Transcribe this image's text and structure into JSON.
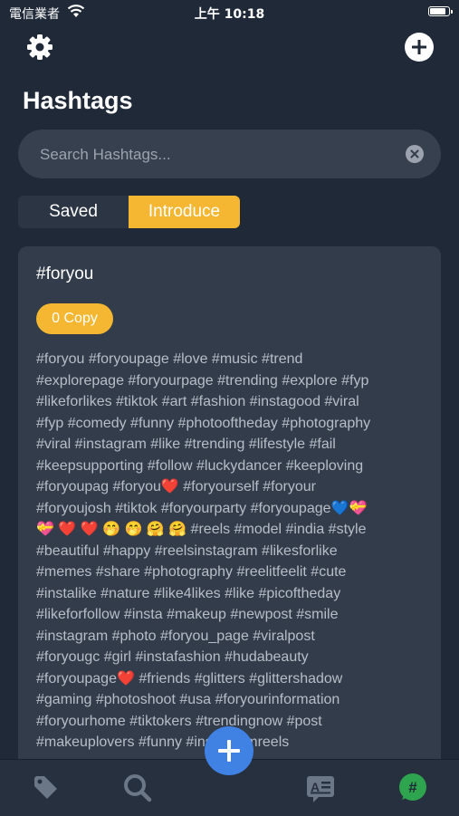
{
  "status_bar": {
    "carrier": "電信業者",
    "time": "上午 10:18",
    "battery_level": 0.95
  },
  "header": {
    "settings_icon": "gear-icon",
    "add_icon": "plus-circle-icon",
    "title": "Hashtags"
  },
  "search": {
    "placeholder": "Search Hashtags...",
    "value": "",
    "clear_icon": "x-circle-icon"
  },
  "tabs": [
    {
      "label": "Saved",
      "active": false
    },
    {
      "label": "Introduce",
      "active": true
    }
  ],
  "card": {
    "title": "#foryou",
    "copy_label": "0 Copy",
    "hashtags": "#foryou #foryoupage #love #music #trend\n#explorepage #foryourpage #trending #explore #fyp\n#likeforlikes #tiktok #art #fashion #instagood #viral\n#fyp #comedy #funny #photooftheday #photography\n#viral #instagram #like #trending #lifestyle #fail\n#keepsupporting #follow #luckydancer #keeploving\n#foryoupag #foryou❤️ #foryourself #foryour\n#foryoujosh #tiktok #foryourparty #foryoupage💙💝\n💝 ❤️ ❤️ 🤭 🤭 🤗 🤗 #reels #model #india #style\n#beautiful #happy #reelsinstagram #likesforlike\n#memes #share #photography #reelitfeelit #cute\n#instalike #nature #like4likes #like #picoftheday\n#likeforfollow #insta #makeup #newpost #smile\n#instagram #photo #foryou_page #viralpost\n#foryougc #girl #instafashion #hudabeauty\n#foryoupage❤️ #friends #glitters #glittershadow\n#gaming #photoshoot #usa #foryourinformation\n#foryourhome #tiktokers #trendingnow #post\n#makeuplovers #funny #instagramreels"
  },
  "tab_bar": {
    "items": [
      {
        "icon": "tag-icon",
        "active": false
      },
      {
        "icon": "search-icon",
        "active": false
      },
      {
        "icon": "plus-icon",
        "active": false
      },
      {
        "icon": "article-icon",
        "active": false
      },
      {
        "icon": "hashtag-icon",
        "active": true
      }
    ]
  },
  "colors": {
    "background": "#1f2937",
    "accent": "#f5b731",
    "fab": "#3f82e4",
    "active_tab": "#2ea44f"
  }
}
